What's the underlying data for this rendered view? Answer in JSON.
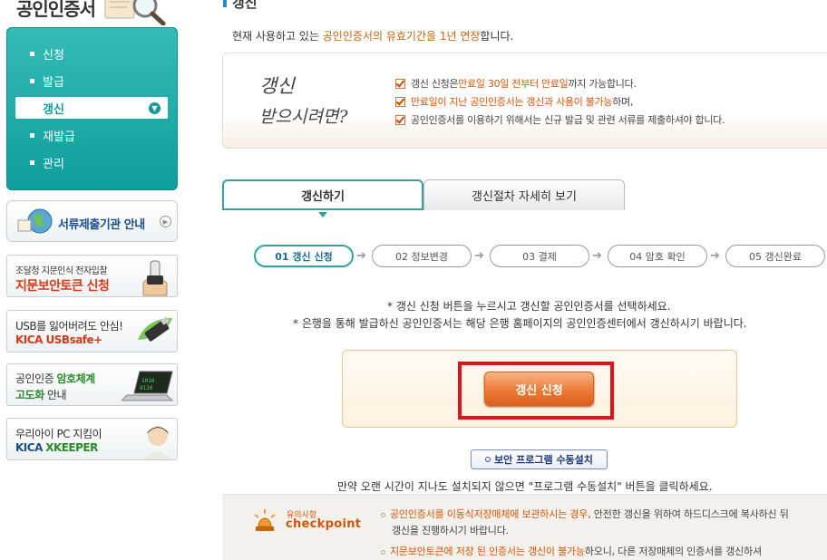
{
  "brand": "공인인증서",
  "sidebar": {
    "items": [
      {
        "label": "신청"
      },
      {
        "label": "발급"
      },
      {
        "label": "갱신"
      },
      {
        "label": "재발급"
      },
      {
        "label": "관리"
      }
    ],
    "banners": {
      "institution": "서류제출기관 안내",
      "fingerprint_top": "조달청 지문인식 전자입찰",
      "fingerprint_main": "지문보안토큰 신청",
      "usb_top": "USB를 잃어버려도 안심!",
      "usb_main": "KICA USBsafe+",
      "crypto_1a": "공인인증",
      "crypto_1b": "암호체계",
      "crypto_2a": "고도화",
      "crypto_2b": "안내",
      "xkeeper_top": "우리아이 PC 지킴이",
      "xkeeper_brand": "KICA",
      "xkeeper_main": "XKEEPER"
    }
  },
  "main": {
    "title": "갱신",
    "intro_1": "현재 사용하고 있는 ",
    "intro_2": "공인인증서의 유효기간을 1년 연장",
    "intro_3": "합니다.",
    "notice": {
      "hand_line_1": "갱신",
      "hand_line_2": "받으시려면?",
      "line1_a": "갱신 신청은 ",
      "line1_b": "만료일 30일 전부터 만료일",
      "line1_c": "까지 가능합니다.",
      "line2_a": "만료일이 지난 공인인증서는 갱신과 사용이 불가능",
      "line2_b": "하며,",
      "line3": "공인인증서를 이용하기 위해서는 신규 발급 및 관련 서류를 제출하셔야 합니다."
    },
    "tabs": {
      "active": "갱신하기",
      "inactive": "갱신절차 자세히 보기"
    },
    "steps": [
      "01 갱신 신청",
      "02 정보변경",
      "03 결제",
      "04 암호 확인",
      "05 갱신완료"
    ],
    "guide_1": "* 갱신 신청 버튼을 누르시고 갱신할 공인인증서를 선택하세요.",
    "guide_2": "* 은행을 통해 발급하신 공인인증서는 해당 은행 홈페이지의 공인인증센터에서 갱신하시기 바랍니다.",
    "apply_button": "갱신 신청",
    "manual_button": "보안 프로그램 수동설치",
    "manual_note": "만약 오랜 시간이 지나도 설치되지 않으면 \"프로그램 수동설치\" 버튼을 클릭하세요.",
    "checkpoint": {
      "sub": "유의사항",
      "title": "checkpoint",
      "line1_a": "공인인증서를 이동식저장매체에 보관하시는 경우",
      "line1_b": ", 안전한 갱신을 위하여 하드디스크에 복사하신 뒤",
      "line1_c": "갱신을 진행하시기 바랍니다.",
      "line2_a": "지문보안토큰에 저장 된 인증서는 갱신이 불가능",
      "line2_b": "하오니, 다른 저장매체의 인증서를 갱신하셔"
    }
  },
  "colors": {
    "teal": "#16a3a1",
    "orange": "#d2550a",
    "highlight_red": "#e0121a"
  }
}
